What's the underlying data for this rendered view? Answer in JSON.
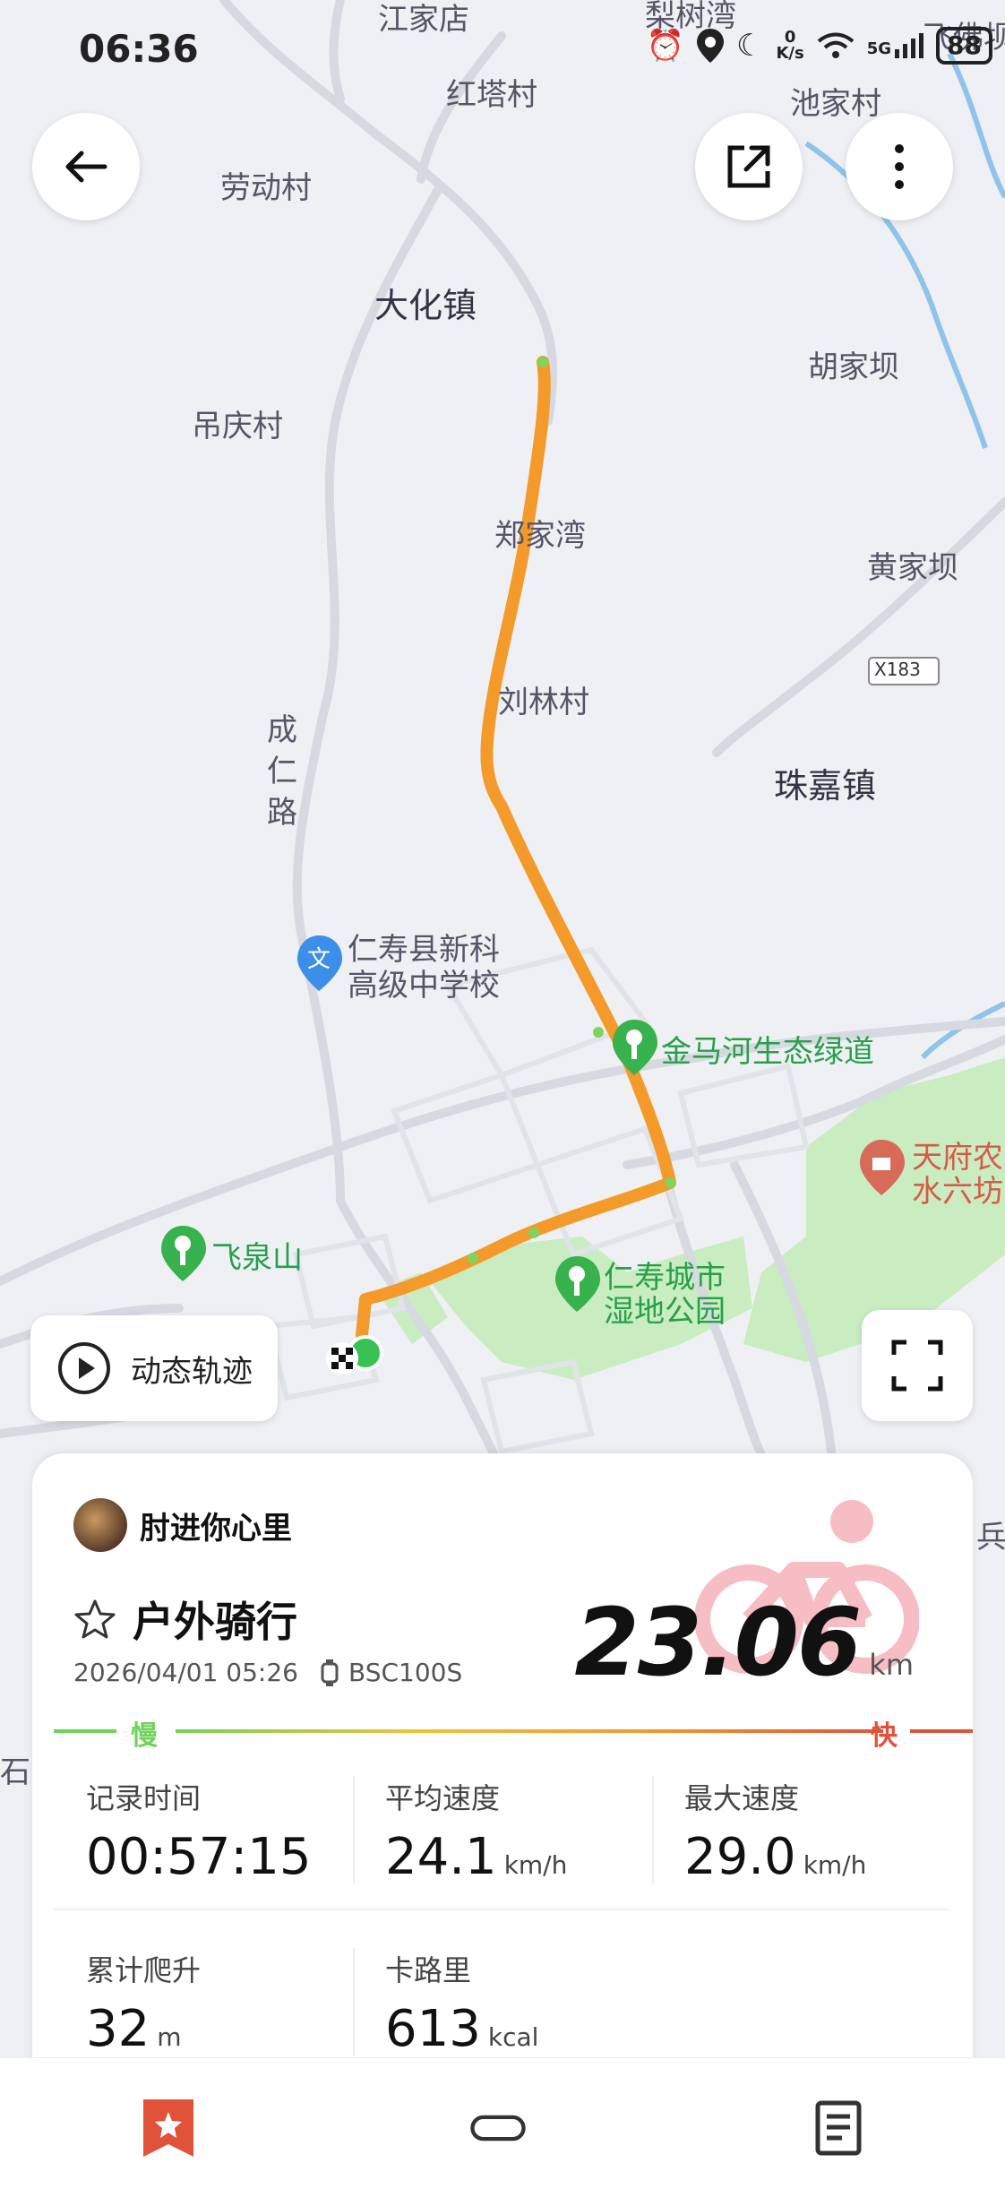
{
  "status_bar": {
    "time": "06:36",
    "net_speed_top": "0",
    "net_speed_unit": "K/s",
    "network": "5G",
    "battery": "88"
  },
  "map": {
    "places": [
      {
        "name": "江家店"
      },
      {
        "name": "梨树湾"
      },
      {
        "name": "红塔村"
      },
      {
        "name": "飞佛坝"
      },
      {
        "name": "池家村"
      },
      {
        "name": "劳动村"
      },
      {
        "name": "大化镇"
      },
      {
        "name": "胡家坝"
      },
      {
        "name": "吊庆村"
      },
      {
        "name": "郑家湾"
      },
      {
        "name": "黄家坝"
      },
      {
        "name": "X183"
      },
      {
        "name": "刘林村"
      },
      {
        "name": "成仁路"
      },
      {
        "name": "珠嘉镇"
      },
      {
        "name": "仁寿县新科"
      },
      {
        "name": "高级中学校"
      },
      {
        "name": "金马河生态绿道"
      },
      {
        "name": "天府农"
      },
      {
        "name": "水六坊"
      },
      {
        "name": "飞泉山"
      },
      {
        "name": "仁寿城市"
      },
      {
        "name": "湿地公园"
      },
      {
        "name": "石"
      },
      {
        "name": "兵"
      }
    ]
  },
  "controls": {
    "replay_label": "动态轨迹"
  },
  "card": {
    "username": "肘进你心里",
    "activity_title": "户外骑行",
    "datetime": "2026/04/01 05:26",
    "device": "BSC100S",
    "distance_value": "23.06",
    "distance_unit": "km",
    "speed_slow": "慢",
    "speed_fast": "快",
    "stats": [
      {
        "label": "记录时间",
        "value": "00:57:15",
        "unit": ""
      },
      {
        "label": "平均速度",
        "value": "24.1",
        "unit": "km/h"
      },
      {
        "label": "最大速度",
        "value": "29.0",
        "unit": "km/h"
      },
      {
        "label": "累计爬升",
        "value": "32",
        "unit": "m"
      },
      {
        "label": "卡路里",
        "value": "613",
        "unit": "kcal"
      }
    ]
  },
  "colors": {
    "route": "#f39a2a",
    "slow": "#6fd35a",
    "fast": "#e0523a",
    "park": "#bfe6b4"
  }
}
